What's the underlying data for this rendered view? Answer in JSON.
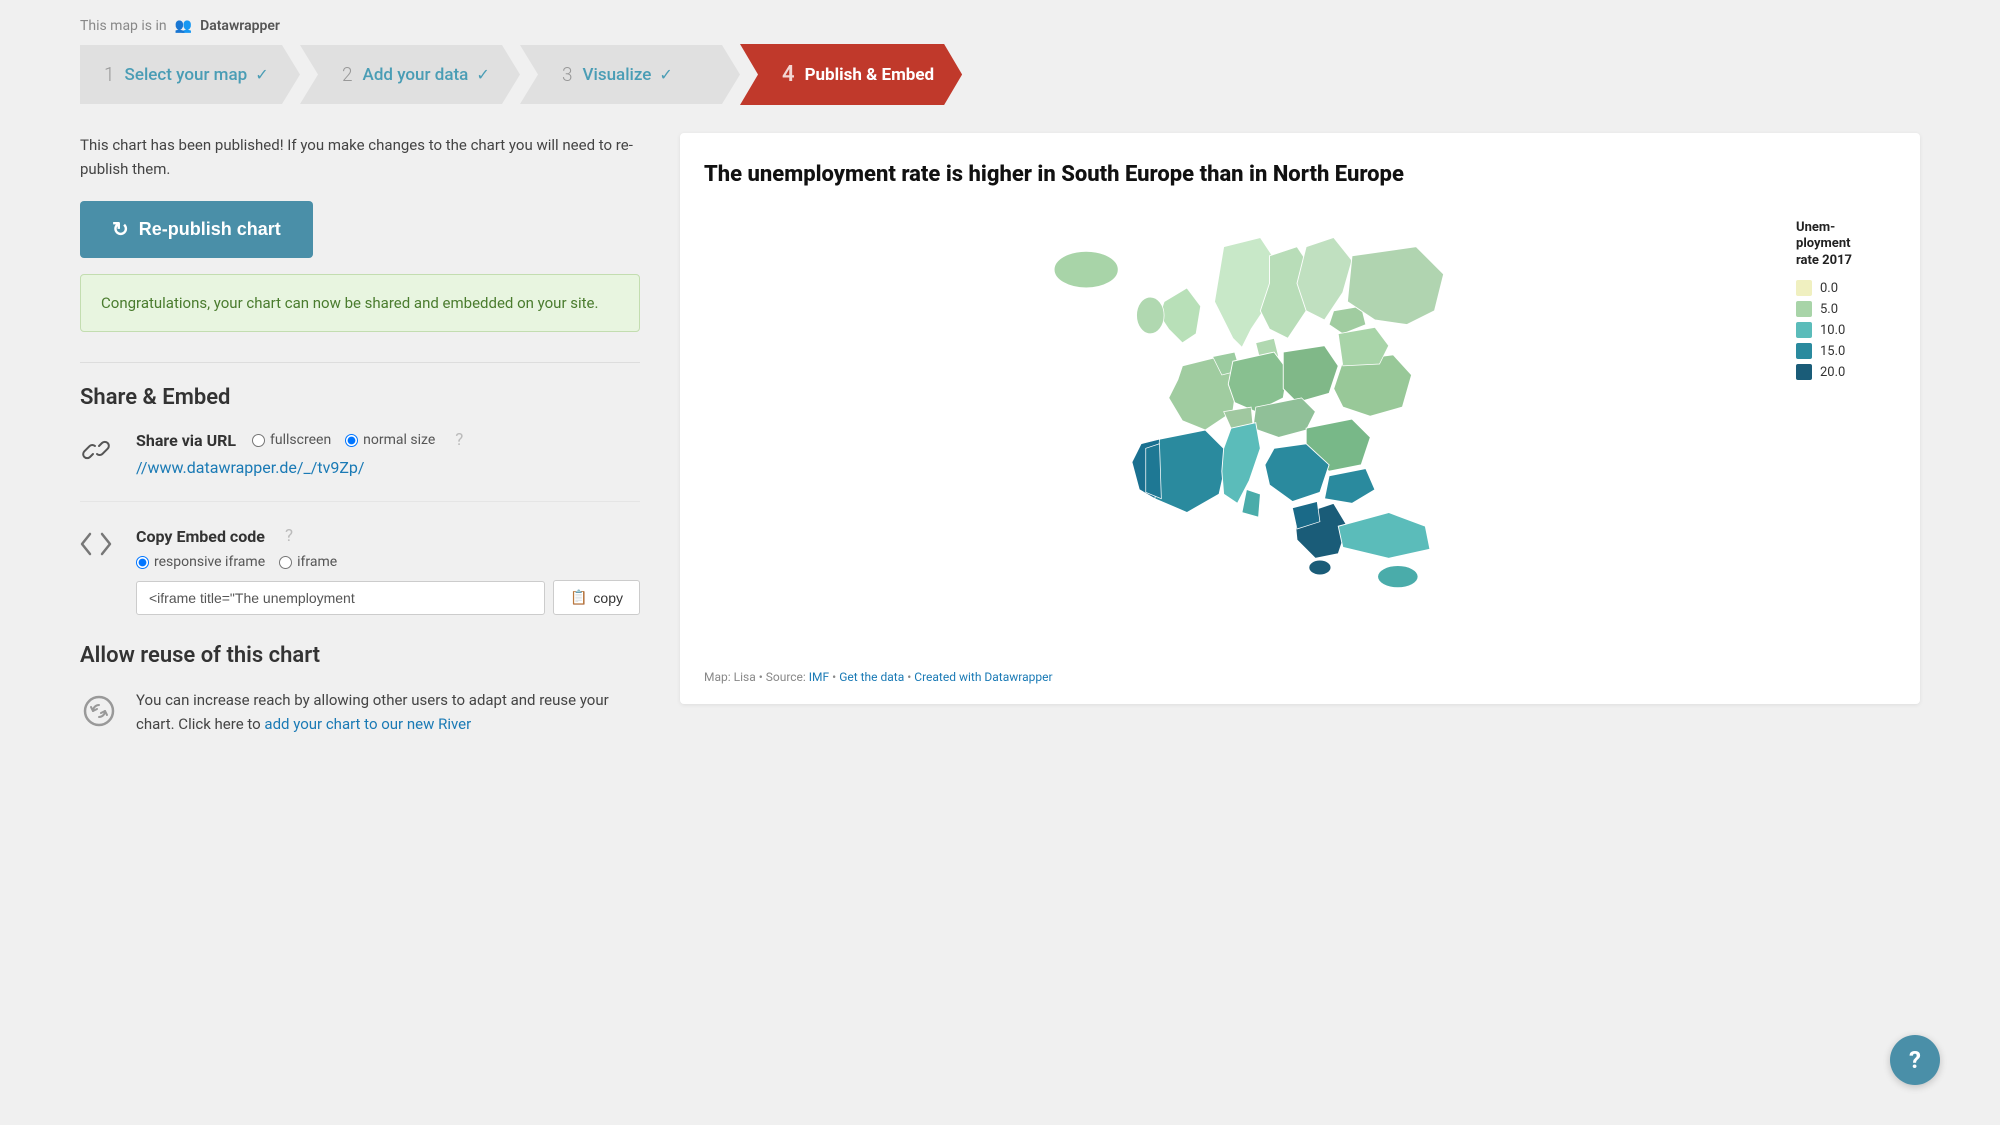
{
  "topbar": {
    "label": "This map is in",
    "brand": "Datawrapper",
    "brand_icon": "🏢"
  },
  "wizard": {
    "steps": [
      {
        "num": "1",
        "label": "Select your map",
        "check": "✓",
        "active": false
      },
      {
        "num": "2",
        "label": "Add your data",
        "check": "✓",
        "active": false
      },
      {
        "num": "3",
        "label": "Visualize",
        "check": "✓",
        "active": false
      },
      {
        "num": "4",
        "label": "Publish & Embed",
        "check": "",
        "active": true
      }
    ]
  },
  "left": {
    "published_notice": "This chart has been published! If you make changes to the chart you will need to re-publish them.",
    "republish_btn": "Re-publish chart",
    "success_msg": "Congratulations, your chart can now be shared and embedded on your site.",
    "share_embed_title": "Share & Embed",
    "share_url": {
      "label": "Share via URL",
      "options": [
        "fullscreen",
        "normal size"
      ],
      "selected": "normal size",
      "url": "//www.datawrapper.de/_/tv9Zp/"
    },
    "embed": {
      "label": "Copy Embed code",
      "options": [
        "responsive iframe",
        "iframe"
      ],
      "selected": "responsive iframe",
      "code": "<iframe title=\"The unemployment"
    },
    "copy_label": "copy",
    "allow_reuse_title": "Allow reuse of this chart",
    "allow_reuse_text": "You can increase reach by allowing other users to adapt and reuse your chart. Click here to",
    "allow_reuse_link": "add your chart to our new River"
  },
  "map": {
    "title": "The unemployment rate is higher in South Europe than in North Europe",
    "legend_title": "Unem-\nployment\nrate 2017",
    "legend": [
      {
        "label": "0.0",
        "color": "#f0f0c0"
      },
      {
        "label": "5.0",
        "color": "#a8d4a8"
      },
      {
        "label": "10.0",
        "color": "#5bbcba"
      },
      {
        "label": "15.0",
        "color": "#2a8a9e"
      },
      {
        "label": "20.0",
        "color": "#1a5c78"
      }
    ],
    "footer": "Map: Lisa • Source:",
    "footer_links": [
      "IMF",
      "Get the data",
      "Created with Datawrapper"
    ]
  },
  "help_btn": "?"
}
